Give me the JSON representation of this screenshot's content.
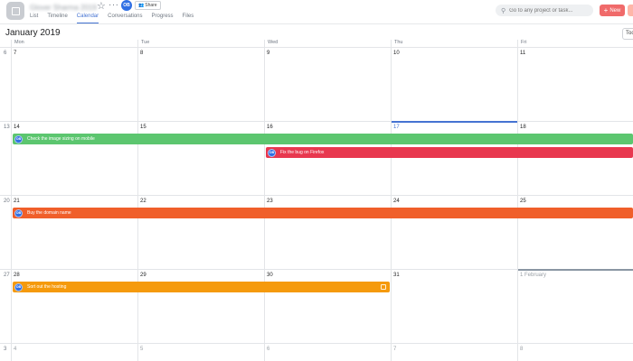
{
  "header": {
    "project_name": "Glover Sharma 2019",
    "owner_avatar": "OB",
    "share_label": "Share",
    "tabs": [
      {
        "label": "List",
        "active": false
      },
      {
        "label": "Timeline",
        "active": false
      },
      {
        "label": "Calendar",
        "active": true
      },
      {
        "label": "Conversations",
        "active": false
      },
      {
        "label": "Progress",
        "active": false
      },
      {
        "label": "Files",
        "active": false
      }
    ],
    "search_placeholder": "Go to any project or task...",
    "new_button_label": "New",
    "icons": {
      "project": "project-icon",
      "star": "star-icon",
      "more": "more-icon",
      "share": "people-icon",
      "search": "search-icon",
      "plus": "plus-icon"
    }
  },
  "calendar": {
    "month_title": "January 2019",
    "today_label": "Toc",
    "weekdays": [
      "Mon",
      "Tue",
      "Wed",
      "Thu",
      "Fri"
    ],
    "weeks": [
      {
        "week": "6",
        "days": [
          "7",
          "8",
          "9",
          "10",
          "11"
        ]
      },
      {
        "week": "13",
        "days": [
          "14",
          "15",
          "16",
          "17",
          "18"
        ]
      },
      {
        "week": "20",
        "days": [
          "21",
          "22",
          "23",
          "24",
          "25"
        ]
      },
      {
        "week": "27",
        "days": [
          "28",
          "29",
          "30",
          "31",
          "1 February"
        ]
      },
      {
        "week": "3",
        "days": [
          "4",
          "5",
          "6",
          "7",
          "8"
        ]
      }
    ],
    "today": "17",
    "tasks": [
      {
        "title": "Check the image sizing on mobile",
        "assignee": "OB",
        "color": "#5cc66f"
      },
      {
        "title": "Fix the bug on Firefox",
        "assignee": "OB",
        "color": "#e8384f"
      },
      {
        "title": "Buy the domain name",
        "assignee": "OB",
        "color": "#f05f2a"
      },
      {
        "title": "Sort out the hosting",
        "assignee": "OB",
        "color": "#f59a0c"
      }
    ]
  },
  "colors": {
    "accent": "#4573d2",
    "new_button": "#f06a6a",
    "avatar": "#2f6fe4"
  }
}
